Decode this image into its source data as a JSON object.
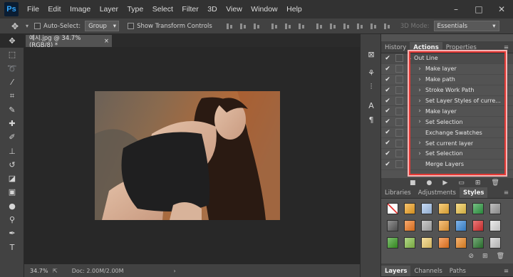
{
  "app": {
    "logo": "Ps"
  },
  "menu": [
    "File",
    "Edit",
    "Image",
    "Layer",
    "Type",
    "Select",
    "Filter",
    "3D",
    "View",
    "Window",
    "Help"
  ],
  "window_controls": [
    "–",
    "□",
    "✕"
  ],
  "options": {
    "auto_select": "Auto-Select:",
    "auto_select_value": "Group",
    "show_transform": "Show Transform Controls",
    "mode_3d": "3D Mode:",
    "workspace": "Essentials"
  },
  "document": {
    "tab_title": "예시.jpg @ 34.7% (RGB/8) *",
    "close": "×"
  },
  "status": {
    "zoom": "34.7%",
    "doc_size": "Doc: 2.00M/2.00M",
    "arrow": "›"
  },
  "actions_panel": {
    "tabs": [
      "History",
      "Actions",
      "Properties"
    ],
    "active_tab": "Actions",
    "set_name": "Out Line",
    "items": [
      {
        "label": "Make layer",
        "expandable": true
      },
      {
        "label": "Make path",
        "expandable": true
      },
      {
        "label": "Stroke Work Path",
        "expandable": true
      },
      {
        "label": "Set Layer Styles of curre...",
        "expandable": true
      },
      {
        "label": "Make layer",
        "expandable": true
      },
      {
        "label": "Set Selection",
        "expandable": true
      },
      {
        "label": "Exchange Swatches",
        "expandable": false
      },
      {
        "label": "Set current layer",
        "expandable": true
      },
      {
        "label": "Set Selection",
        "expandable": true
      },
      {
        "label": "Merge Layers",
        "expandable": false
      }
    ],
    "highlight_color": "#e53935"
  },
  "styles_panel": {
    "tabs": [
      "Libraries",
      "Adjustments",
      "Styles"
    ],
    "active_tab": "Styles",
    "swatch_colors": [
      "none",
      "#f5a623",
      "#a9c8f0",
      "#f5b53a",
      "#f2c94c",
      "#2f9e44",
      "#9e9e9e",
      "#5a5a5a",
      "#f57c20",
      "#b0b0b0",
      "#f2a13a",
      "#3d8ee0",
      "#e03131",
      "#e0e0e0",
      "#3a9d23",
      "#8bc34a",
      "#f3d170",
      "#f57c20",
      "#f08a24",
      "#2e7d32",
      "#cfcfcf"
    ]
  },
  "layers_panel": {
    "tabs": [
      "Layers",
      "Channels",
      "Paths"
    ],
    "active_tab": "Layers"
  }
}
